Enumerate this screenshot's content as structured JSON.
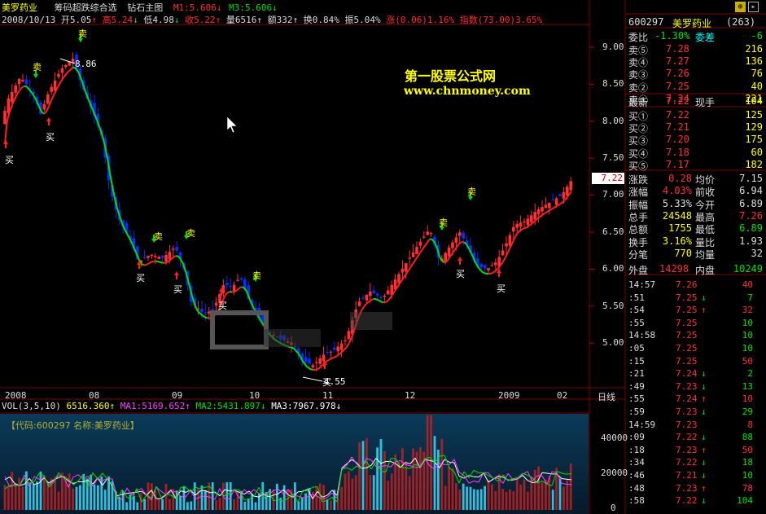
{
  "header": {
    "stock_tab": "美罗药业",
    "indicator_name": "筹码超跌综合选",
    "main_chart": "钻石主图",
    "m1": "M1:5.606",
    "m3": "M3:5.606",
    "date": "2008/10/13",
    "open": "开5.05",
    "high": "高5.24",
    "low": "低4.98",
    "close": "收5.22",
    "volume": "量6516",
    "amount": "额332",
    "turnover": "换0.84%",
    "amplitude": "振5.04%",
    "change": "涨(0.06)1.16%",
    "index": "指数(73.00)3.65%"
  },
  "watermark": {
    "line1": "第一股票公式网",
    "line2": "www.chnmoney.com"
  },
  "price_axis": {
    "ticks": [
      "9.00",
      "8.50",
      "8.00",
      "7.50",
      "7.00",
      "6.50",
      "6.00",
      "5.50",
      "5.00"
    ],
    "current_price_label": "7.22",
    "high_label": "8.86",
    "low_label": "4.55"
  },
  "time_axis": {
    "labels": [
      "2008",
      "08",
      "09",
      "10",
      "11",
      "12",
      "2009",
      "02"
    ],
    "period": "日线"
  },
  "signals": {
    "buy": "买",
    "sell": "卖"
  },
  "volume_header": {
    "name": "VOL(3,5,10)",
    "vol": "6516.360",
    "ma1": "MA1:5169.652",
    "ma2": "MA2:5431.897",
    "ma3": "MA3:7967.978"
  },
  "volume_panel": {
    "info": "【代码:600297 名称:美罗药业】",
    "ticks": [
      "40000",
      "20000",
      "0"
    ]
  },
  "quote_panel": {
    "code": "600297",
    "name": "美罗药业",
    "count": "(263)",
    "weibi_label": "委比",
    "weibi": "-1.30%",
    "weicha_label": "委差",
    "weicha": "-6",
    "asks": [
      {
        "label": "卖⑤",
        "price": "7.28",
        "vol": "216"
      },
      {
        "label": "卖④",
        "price": "7.27",
        "vol": "136"
      },
      {
        "label": "卖③",
        "price": "7.26",
        "vol": "76"
      },
      {
        "label": "卖②",
        "price": "7.25",
        "vol": "40"
      },
      {
        "label": "卖①",
        "price": "7.24",
        "vol": "221"
      }
    ],
    "last_label": "最新",
    "last": "7.22",
    "hand_label": "现手",
    "hand": "104",
    "bids": [
      {
        "label": "买①",
        "price": "7.22",
        "vol": "125"
      },
      {
        "label": "买②",
        "price": "7.21",
        "vol": "129"
      },
      {
        "label": "买③",
        "price": "7.20",
        "vol": "175"
      },
      {
        "label": "买④",
        "price": "7.18",
        "vol": "60"
      },
      {
        "label": "买⑤",
        "price": "7.17",
        "vol": "182"
      }
    ],
    "stats": [
      {
        "l1": "涨跌",
        "v1": "0.28",
        "l2": "均价",
        "v2": "7.15"
      },
      {
        "l1": "涨幅",
        "v1": "4.03%",
        "l2": "前收",
        "v2": "6.94"
      },
      {
        "l1": "振幅",
        "v1": "5.33%",
        "l2": "今开",
        "v2": "6.89"
      },
      {
        "l1": "总手",
        "v1": "24548",
        "l2": "最高",
        "v2": "7.26"
      },
      {
        "l1": "总额",
        "v1": "1755",
        "l2": "最低",
        "v2": "6.89"
      },
      {
        "l1": "换手",
        "v1": "3.16%",
        "l2": "量比",
        "v2": "1.93"
      },
      {
        "l1": "分笔",
        "v1": "770",
        "l2": "均量",
        "v2": "32"
      }
    ],
    "outer_label": "外盘",
    "outer": "14298",
    "inner_label": "内盘",
    "inner": "10249"
  },
  "ticks": [
    {
      "time": "14:57",
      "price": "7.26",
      "arrow": "",
      "vol": "40",
      "dir": "up"
    },
    {
      "time": ":51",
      "price": "7.25",
      "arrow": "↓",
      "vol": "7",
      "dir": "down"
    },
    {
      "time": ":54",
      "price": "7.25",
      "arrow": "↑",
      "vol": "32",
      "dir": "up"
    },
    {
      "time": ":55",
      "price": "7.25",
      "arrow": "",
      "vol": "10",
      "dir": "down"
    },
    {
      "time": "14:58",
      "price": "7.25",
      "arrow": "",
      "vol": "10",
      "dir": "down"
    },
    {
      "time": ":05",
      "price": "7.25",
      "arrow": "",
      "vol": "10",
      "dir": "down"
    },
    {
      "time": ":15",
      "price": "7.25",
      "arrow": "",
      "vol": "50",
      "dir": "up"
    },
    {
      "time": ":21",
      "price": "7.24",
      "arrow": "↓",
      "vol": "2",
      "dir": "down"
    },
    {
      "time": ":49",
      "price": "7.23",
      "arrow": "↓",
      "vol": "13",
      "dir": "down"
    },
    {
      "time": ":55",
      "price": "7.24",
      "arrow": "↑",
      "vol": "10",
      "dir": "up"
    },
    {
      "time": ":59",
      "price": "7.23",
      "arrow": "↓",
      "vol": "29",
      "dir": "down"
    },
    {
      "time": "14:59",
      "price": "7.23",
      "arrow": "",
      "vol": "8",
      "dir": "up"
    },
    {
      "time": ":09",
      "price": "7.22",
      "arrow": "↓",
      "vol": "88",
      "dir": "down"
    },
    {
      "time": ":18",
      "price": "7.23",
      "arrow": "↑",
      "vol": "50",
      "dir": "up"
    },
    {
      "time": ":34",
      "price": "7.22",
      "arrow": "↓",
      "vol": "18",
      "dir": "down"
    },
    {
      "time": ":46",
      "price": "7.21",
      "arrow": "↓",
      "vol": "10",
      "dir": "down"
    },
    {
      "time": ":48",
      "price": "7.23",
      "arrow": "↑",
      "vol": "78",
      "dir": "up"
    },
    {
      "time": ":58",
      "price": "7.22",
      "arrow": "↓",
      "vol": "104",
      "dir": "down"
    }
  ],
  "colors": {
    "up": "#ff3030",
    "down": "#0030ff",
    "ma_up": "#ff2020",
    "ma_down": "#00e000",
    "grid": "#800000",
    "vol_bg": "#103050"
  }
}
